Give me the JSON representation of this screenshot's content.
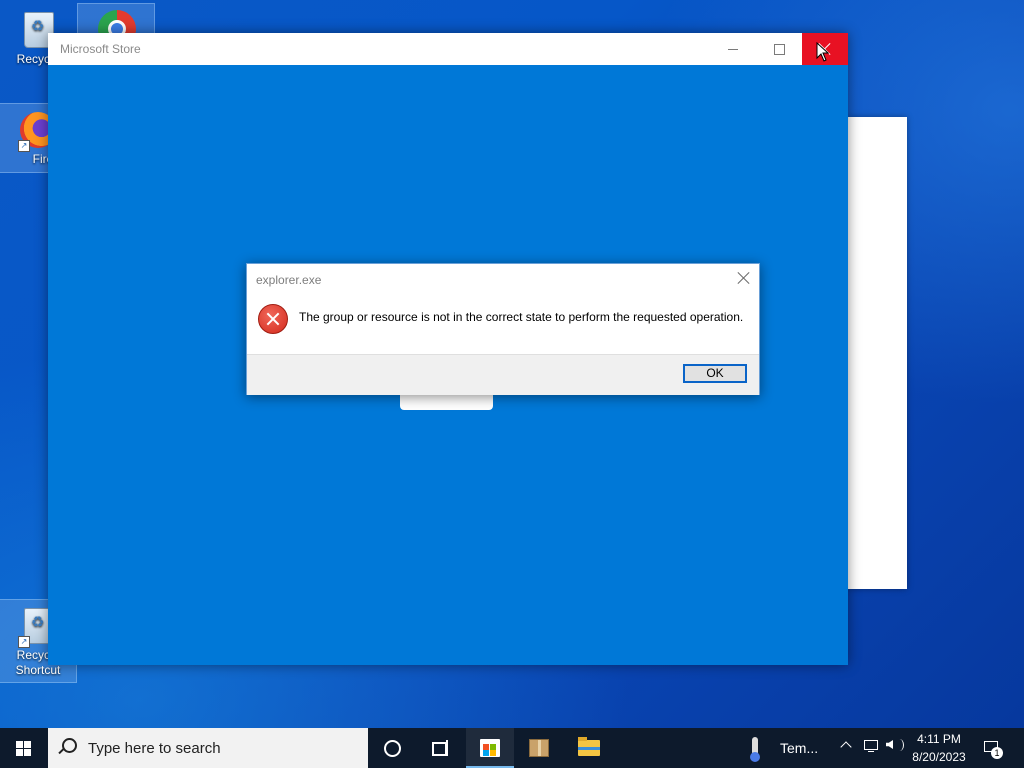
{
  "desktop": {
    "icons": [
      {
        "label": "Recycle"
      },
      {
        "label": ""
      },
      {
        "label": "Firefo"
      },
      {
        "label": "Recycle",
        "label2": "Shortcut"
      }
    ]
  },
  "store_window": {
    "title": "Microsoft Store"
  },
  "dialog": {
    "title": "explorer.exe",
    "message": "The group or resource is not in the correct state to perform the requested operation.",
    "ok_label": "OK"
  },
  "taskbar": {
    "search_placeholder": "Type here to search",
    "weather_text": "Tem...",
    "time": "4:11 PM",
    "date": "8/20/2023",
    "notification_count": "1"
  },
  "colors": {
    "store_bg": "#0078d7",
    "close_red": "#e81123",
    "taskbar": "#0d1a2c"
  }
}
